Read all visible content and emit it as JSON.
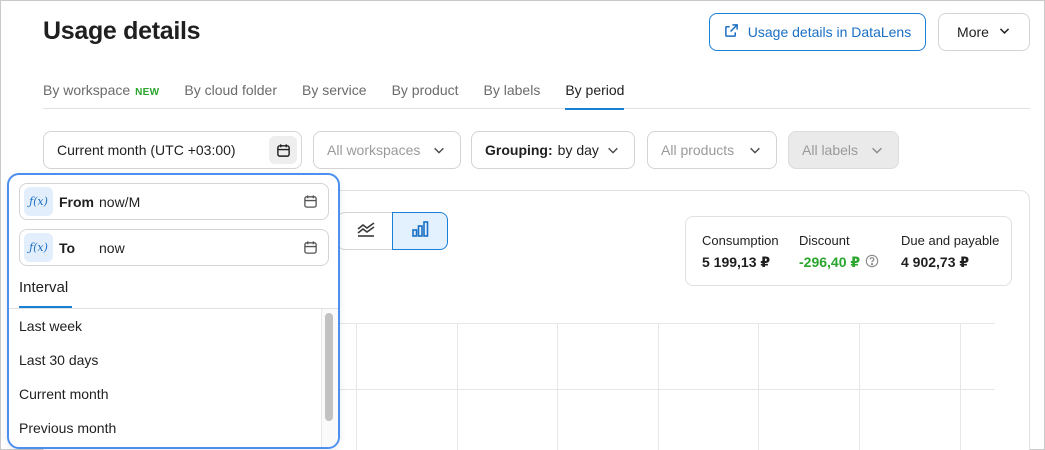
{
  "page": {
    "title": "Usage details"
  },
  "header": {
    "datalens_label": "Usage details in DataLens",
    "more_label": "More"
  },
  "tabs": [
    {
      "label": "By workspace",
      "badge": "NEW"
    },
    {
      "label": "By cloud folder"
    },
    {
      "label": "By service"
    },
    {
      "label": "By product"
    },
    {
      "label": "By labels"
    },
    {
      "label": "By period",
      "active": true
    }
  ],
  "filters": {
    "period": "Current month (UTC +03:00)",
    "workspaces": "All workspaces",
    "grouping_label": "Grouping:",
    "grouping_value": "by day",
    "products": "All products",
    "labels": "All labels"
  },
  "summary": {
    "consumption_label": "Consumption",
    "consumption_value": "5 199,13 ₽",
    "discount_label": "Discount",
    "discount_value": "-296,40 ₽",
    "due_label": "Due and payable",
    "due_value": "4 902,73 ₽"
  },
  "popup": {
    "from_label": "From",
    "from_value": "now/M",
    "to_label": "To",
    "to_value": "now",
    "interval_tab": "Interval",
    "intervals": [
      "Last week",
      "Last 30 days",
      "Current month",
      "Previous month"
    ]
  },
  "colors": {
    "accent": "#1a7fd6",
    "positive": "#2aa52e",
    "popup_border": "#4d8ff0"
  },
  "icons": {
    "external_link": "external-link-icon",
    "chevron": "chevron-down-icon",
    "calendar": "calendar-icon",
    "function": "function-icon",
    "line_chart": "line-chart-icon",
    "bar_chart": "bar-chart-icon",
    "help": "help-icon"
  }
}
